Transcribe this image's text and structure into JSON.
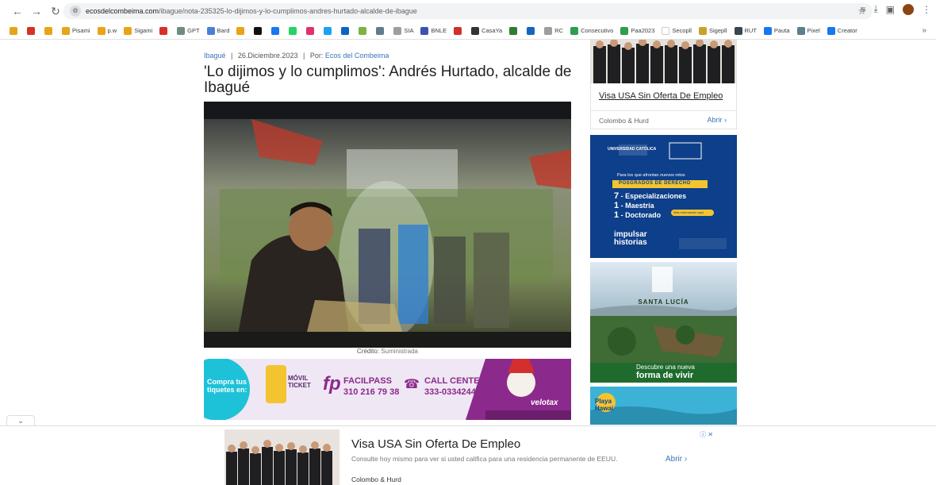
{
  "browser": {
    "url_domain": "ecosdelcombeima.com",
    "url_path": "/ibague/nota-235325-lo-dijimos-y-lo-cumplimos-andres-hurtado-alcalde-de-ibague",
    "bookmarks": [
      {
        "label": "",
        "color": "#e8a317"
      },
      {
        "label": "",
        "color": "#d93025"
      },
      {
        "label": "",
        "color": "#e8a317"
      },
      {
        "label": "Pisami",
        "color": "#e8a317"
      },
      {
        "label": "p.w",
        "color": "#e8a317"
      },
      {
        "label": "Sigami",
        "color": "#e8a317"
      },
      {
        "label": "",
        "color": "#d93025"
      },
      {
        "label": "GPT",
        "color": "#6b8f7c"
      },
      {
        "label": "Bard",
        "color": "#4a7fd6"
      },
      {
        "label": "",
        "color": "#e8a317"
      },
      {
        "label": "",
        "color": "#111111"
      },
      {
        "label": "",
        "color": "#1877f2"
      },
      {
        "label": "",
        "color": "#25d366"
      },
      {
        "label": "",
        "color": "#e1306c"
      },
      {
        "label": "",
        "color": "#1da1f2"
      },
      {
        "label": "",
        "color": "#0a66c2"
      },
      {
        "label": "",
        "color": "#7cb342"
      },
      {
        "label": "",
        "color": "#607d8b"
      },
      {
        "label": "SIA",
        "color": "#9e9e9e"
      },
      {
        "label": "BNLE",
        "color": "#3f51b5"
      },
      {
        "label": "",
        "color": "#d32f2f"
      },
      {
        "label": "CasaYa",
        "color": "#333333"
      },
      {
        "label": "",
        "color": "#2e7d32"
      },
      {
        "label": "",
        "color": "#1565c0"
      },
      {
        "label": "RC",
        "color": "#9e9e9e"
      },
      {
        "label": "Consecutivo",
        "color": "#2e9e4f"
      },
      {
        "label": "Paa2023",
        "color": "#2e9e4f"
      },
      {
        "label": "Secopll",
        "color": "#ffffff"
      },
      {
        "label": "Sigepll",
        "color": "#c9a227"
      },
      {
        "label": "RUT",
        "color": "#37474f"
      },
      {
        "label": "Pauta",
        "color": "#1877f2"
      },
      {
        "label": "Pixel",
        "color": "#607d8b"
      },
      {
        "label": "Creator",
        "color": "#1877f2"
      }
    ],
    "more_label": "»"
  },
  "article": {
    "breadcrumb_section": "Ibagué",
    "date": "26.Diciembre.2023",
    "by_label": "Por:",
    "author": "Ecos del Combeima",
    "separator": "|",
    "title": "'Lo dijimos y lo cumplimos': Andrés Hurtado, alcalde de Ibagué",
    "credit_label": "Crédito:",
    "credit_value": "Suministrada"
  },
  "banner_ad": {
    "lead": "Compra tus tiquetes en:",
    "movil": "MÓVIL TICKET",
    "facilpass_label": "FACILPASS",
    "facilpass_number": "310 216 79 38",
    "call_label": "CALL CENTER",
    "call_number": "333-0334244",
    "brand": "velotax"
  },
  "side_ads": {
    "ad1_title": "Visa USA Sin Oferta De Empleo",
    "ad1_source": "Colombo & Hurd",
    "ad1_open": "Abrir",
    "ad2_university": "UNIVERSIDAD CATÓLICA",
    "ad2_tagline": "Para los que afrontan nuevos retos",
    "ad2_program": "POSGRADOS DE DERECHO",
    "ad2_line1_num": "7",
    "ad2_line1": "- Especializaciones",
    "ad2_line2_num": "1",
    "ad2_line2": "- Maestría",
    "ad2_line3_num": "1",
    "ad2_line3": "- Doctorado",
    "ad2_cta": "Más información aquí",
    "ad2_brand": "impulsar historias",
    "ad3_name": "SANTA LUCÍA",
    "ad3_line1": "Descubre una nueva",
    "ad3_line2": "forma de vivir",
    "ad4_name": "Playa Hawai"
  },
  "bottom_ad": {
    "title": "Visa USA Sin Oferta De Empleo",
    "description": "Consulte hoy mismo para ver si usted califica para una residencia permanente de EEUU.",
    "source": "Colombo & Hurd",
    "open_label": "Abrir",
    "adchoices": "ⓘ ✕"
  },
  "colors": {
    "link_blue": "#3a73b8",
    "banner_purple": "#8b2a8c",
    "university_blue": "#0d3f8a",
    "santa_lucia_green": "#1f6b2e"
  }
}
